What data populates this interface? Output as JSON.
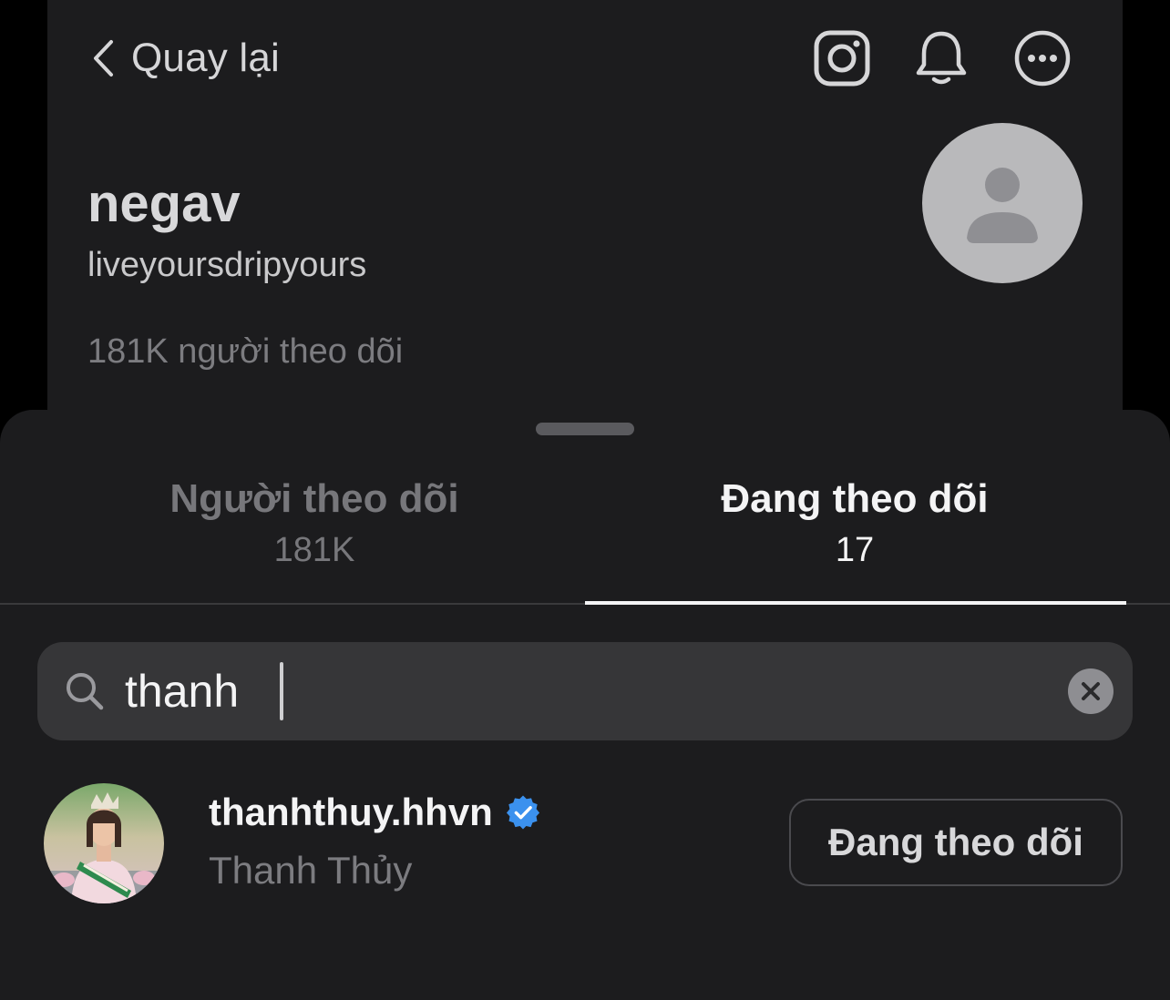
{
  "header": {
    "back_label": "Quay lại",
    "icons": [
      "instagram-icon",
      "bell-icon",
      "more-icon"
    ]
  },
  "profile": {
    "name": "negav",
    "handle": "liveyoursdripyours",
    "followers_text": "181K người theo dõi"
  },
  "tabs": [
    {
      "label": "Người theo dõi",
      "count": "181K",
      "active": false
    },
    {
      "label": "Đang theo dõi",
      "count": "17",
      "active": true
    }
  ],
  "search": {
    "value": "thanh"
  },
  "results": [
    {
      "username": "thanhthuy.hhvn",
      "verified": true,
      "full_name": "Thanh Thủy",
      "button_label": "Đang theo dõi"
    }
  ],
  "colors": {
    "background": "#1c1c1e",
    "verified": "#3b91ee",
    "search_bg": "#363638"
  }
}
